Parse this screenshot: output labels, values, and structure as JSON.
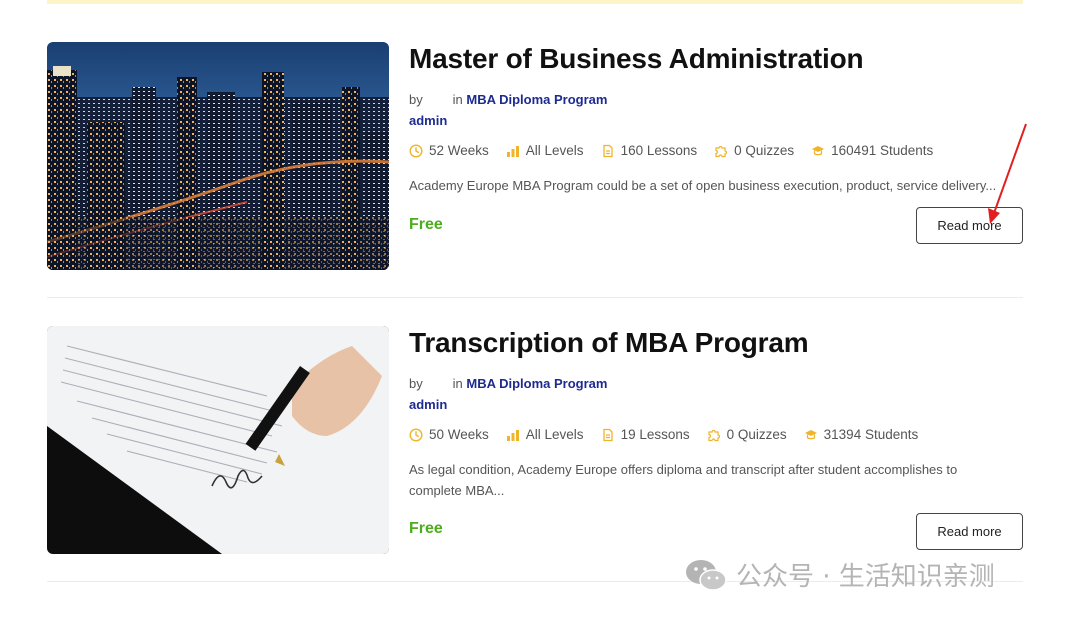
{
  "courses": [
    {
      "title": "Master of Business Administration",
      "by_label": "by",
      "in_label": "in",
      "category": "MBA Diploma Program",
      "author": "admin",
      "duration": "52 Weeks",
      "level": "All Levels",
      "lessons": "160 Lessons",
      "quizzes": "0 Quizzes",
      "students": "160491 Students",
      "description": "Academy Europe MBA Program could be a set of open business execution, product, service delivery...",
      "price": "Free",
      "button_label": "Read more",
      "image": "city-skyline-night"
    },
    {
      "title": "Transcription of MBA Program",
      "by_label": "by",
      "in_label": "in",
      "category": "MBA Diploma Program",
      "author": "admin",
      "duration": "50 Weeks",
      "level": "All Levels",
      "lessons": "19 Lessons",
      "quizzes": "0 Quizzes",
      "students": "31394 Students",
      "description": "As legal condition, Academy Europe offers diploma and transcript after student accomplishes to complete MBA...",
      "price": "Free",
      "button_label": "Read more",
      "image": "hand-signing-document"
    }
  ],
  "watermark": {
    "text": "公众号 · 生活知识亲测",
    "icon": "wechat-icon"
  },
  "colors": {
    "accent": "#1d2a8f",
    "price": "#4cae1e",
    "icon": "#f0b429",
    "annotation": "#e02020"
  }
}
